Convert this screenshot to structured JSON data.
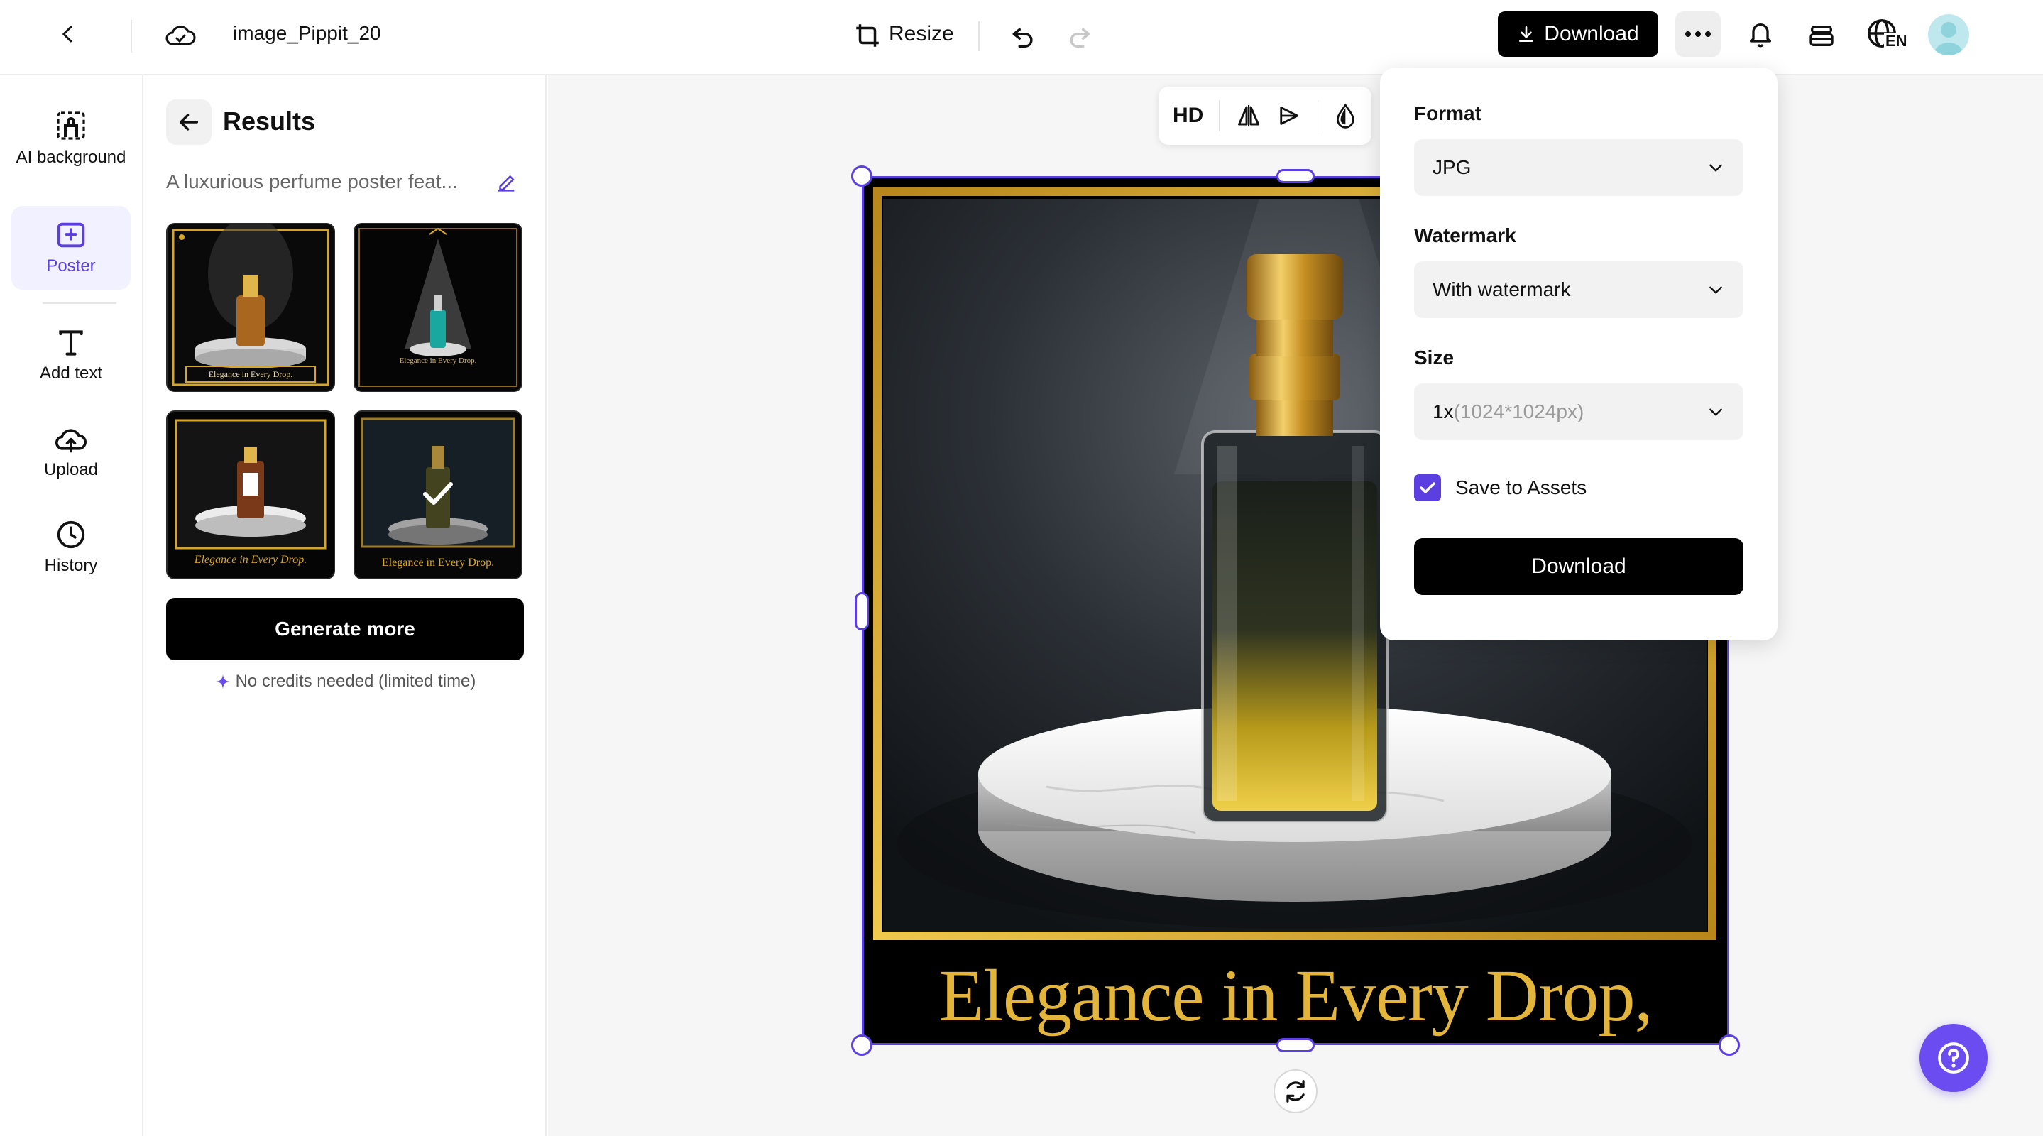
{
  "header": {
    "file_name": "image_Pippit_20",
    "resize_label": "Resize",
    "download_label": "Download",
    "language_code": "EN"
  },
  "rail": {
    "items": [
      {
        "label": "AI background"
      },
      {
        "label": "Poster"
      },
      {
        "label": "Add text"
      },
      {
        "label": "Upload"
      },
      {
        "label": "History"
      }
    ]
  },
  "results": {
    "title": "Results",
    "prompt": "A luxurious perfume poster feat...",
    "thumbnails": [
      {
        "caption": "Elegance in Every Drop."
      },
      {
        "caption": "Elegance in Every Drop."
      },
      {
        "caption": "Elegance in Every Drop."
      },
      {
        "caption": "Elegance in Every Drop."
      }
    ],
    "generate_label": "Generate more",
    "credits_note": "No credits needed (limited time)"
  },
  "toolbar": {
    "hd_label": "HD"
  },
  "poster": {
    "headline": "Elegance in Every Drop,"
  },
  "download_panel": {
    "format_label": "Format",
    "format_value": "JPG",
    "watermark_label": "Watermark",
    "watermark_value": "With watermark",
    "size_label": "Size",
    "size_value": "1x",
    "size_detail": "(1024*1024px)",
    "save_assets_label": "Save to Assets",
    "save_assets_checked": true,
    "download_button": "Download"
  },
  "colors": {
    "accent": "#5b3fe0",
    "gold": "#d4a52a",
    "help_bubble": "#6a4cf0"
  }
}
